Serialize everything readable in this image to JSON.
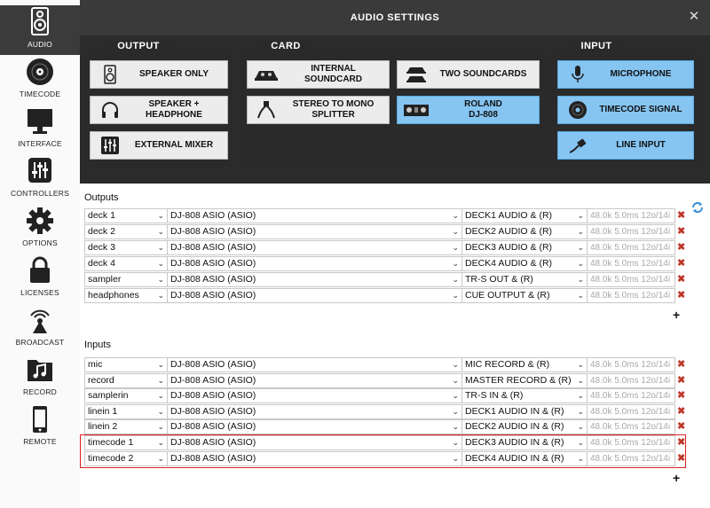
{
  "sidebar": {
    "items": [
      {
        "label": "AUDIO",
        "icon": "speaker-icon"
      },
      {
        "label": "TIMECODE",
        "icon": "vinyl-icon"
      },
      {
        "label": "INTERFACE",
        "icon": "monitor-icon"
      },
      {
        "label": "CONTROLLERS",
        "icon": "sliders-icon"
      },
      {
        "label": "OPTIONS",
        "icon": "gear-icon"
      },
      {
        "label": "LICENSES",
        "icon": "lock-icon"
      },
      {
        "label": "BROADCAST",
        "icon": "antenna-icon"
      },
      {
        "label": "RECORD",
        "icon": "music-folder-icon"
      },
      {
        "label": "REMOTE",
        "icon": "phone-icon"
      }
    ]
  },
  "window": {
    "title": "AUDIO SETTINGS",
    "close": "✕"
  },
  "groups": {
    "output": {
      "label": "OUTPUT",
      "buttons": [
        {
          "label": "SPEAKER ONLY",
          "icon": "speaker-icon"
        },
        {
          "label": "SPEAKER +\nHEADPHONE",
          "icon": "headphones-icon"
        },
        {
          "label": "EXTERNAL MIXER",
          "icon": "mixer-icon"
        }
      ]
    },
    "card": {
      "label": "CARD",
      "buttons": [
        {
          "label": "INTERNAL\nSOUNDCARD",
          "icon": "controller-icon"
        },
        {
          "label": "TWO SOUNDCARDS",
          "icon": "dual-card-icon"
        },
        {
          "label": "STEREO TO MONO\nSPLITTER",
          "icon": "splitter-cable-icon"
        },
        {
          "label": "ROLAND\nDJ-808",
          "icon": "dj-808-icon"
        }
      ]
    },
    "input": {
      "label": "INPUT",
      "buttons": [
        {
          "label": "MICROPHONE",
          "icon": "microphone-icon"
        },
        {
          "label": "TIMECODE SIGNAL",
          "icon": "vinyl-icon"
        },
        {
          "label": "LINE INPUT",
          "icon": "cable-plug-icon"
        }
      ]
    }
  },
  "selected_color": "#86c5f2",
  "outputs": {
    "title": "Outputs",
    "rows": [
      {
        "name": "deck 1",
        "device": "DJ-808 ASIO (ASIO)",
        "channel": "DECK1 AUDIO & (R)",
        "info": "48.0k 5.0ms 12o/14i"
      },
      {
        "name": "deck 2",
        "device": "DJ-808 ASIO (ASIO)",
        "channel": "DECK2 AUDIO & (R)",
        "info": "48.0k 5.0ms 12o/14i"
      },
      {
        "name": "deck 3",
        "device": "DJ-808 ASIO (ASIO)",
        "channel": "DECK3 AUDIO & (R)",
        "info": "48.0k 5.0ms 12o/14i"
      },
      {
        "name": "deck 4",
        "device": "DJ-808 ASIO (ASIO)",
        "channel": "DECK4 AUDIO & (R)",
        "info": "48.0k 5.0ms 12o/14i"
      },
      {
        "name": "sampler",
        "device": "DJ-808 ASIO (ASIO)",
        "channel": "TR-S OUT & (R)",
        "info": "48.0k 5.0ms 12o/14i"
      },
      {
        "name": "headphones",
        "device": "DJ-808 ASIO (ASIO)",
        "channel": "CUE OUTPUT & (R)",
        "info": "48.0k 5.0ms 12o/14i"
      }
    ]
  },
  "inputs": {
    "title": "Inputs",
    "rows": [
      {
        "name": "mic",
        "device": "DJ-808 ASIO (ASIO)",
        "channel": "MIC RECORD & (R)",
        "info": "48.0k 5.0ms 12o/14i"
      },
      {
        "name": "record",
        "device": "DJ-808 ASIO (ASIO)",
        "channel": "MASTER RECORD & (R)",
        "info": "48.0k 5.0ms 12o/14i"
      },
      {
        "name": "samplerin",
        "device": "DJ-808 ASIO (ASIO)",
        "channel": "TR-S IN & (R)",
        "info": "48.0k 5.0ms 12o/14i"
      },
      {
        "name": "linein 1",
        "device": "DJ-808 ASIO (ASIO)",
        "channel": "DECK1 AUDIO IN & (R)",
        "info": "48.0k 5.0ms 12o/14i"
      },
      {
        "name": "linein 2",
        "device": "DJ-808 ASIO (ASIO)",
        "channel": "DECK2 AUDIO IN & (R)",
        "info": "48.0k 5.0ms 12o/14i"
      },
      {
        "name": "timecode 1",
        "device": "DJ-808 ASIO (ASIO)",
        "channel": "DECK3 AUDIO IN & (R)",
        "info": "48.0k 5.0ms 12o/14i"
      },
      {
        "name": "timecode 2",
        "device": "DJ-808 ASIO (ASIO)",
        "channel": "DECK4 AUDIO IN & (R)",
        "info": "48.0k 5.0ms 12o/14i"
      }
    ]
  },
  "controls": {
    "add": "+",
    "remove": "✖",
    "dropdown": "⌄"
  }
}
